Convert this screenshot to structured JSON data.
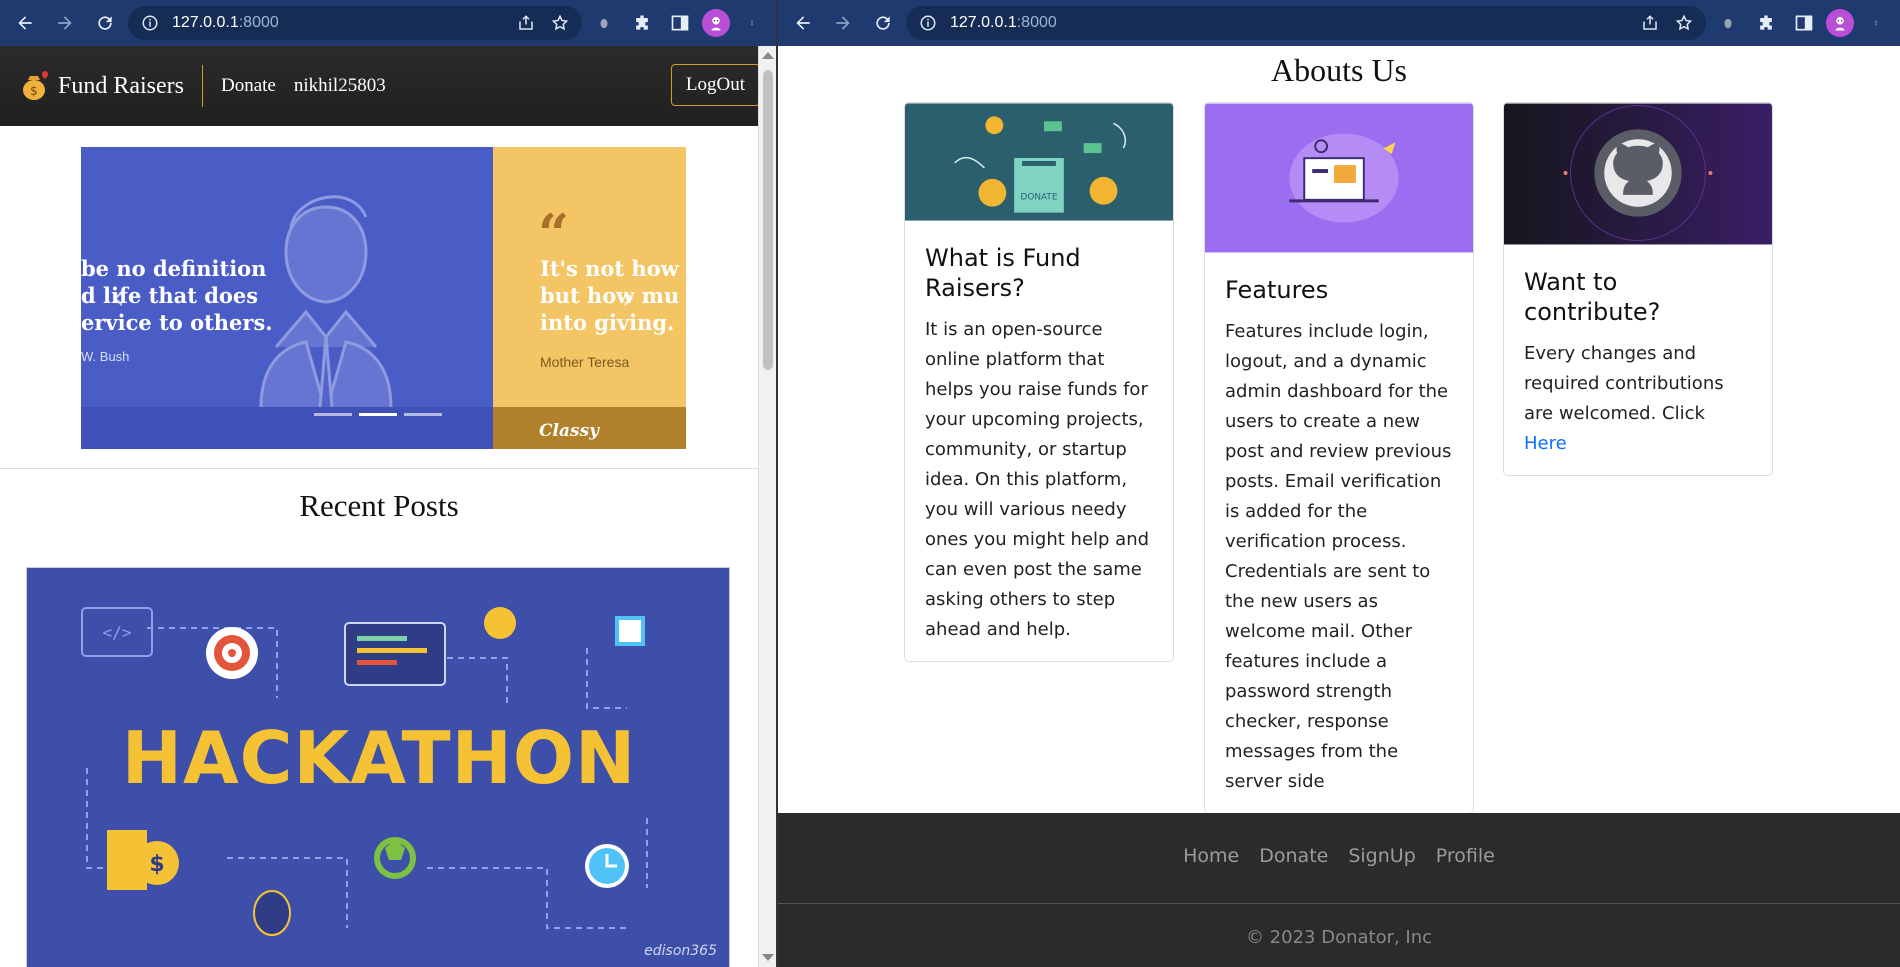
{
  "left_window": {
    "address_bar": {
      "host": "127.0.0.1",
      "port": ":8000"
    },
    "site": {
      "brand": "Fund Raisers",
      "nav_links": [
        "Donate",
        "nikhil25803"
      ],
      "logout_label": "LogOut",
      "carousel": {
        "slide1_quote": "be no definition\nd life that does\nervice to others.",
        "slide1_author": "W. Bush",
        "slide2_quote": "It's not how\nbut how mu\ninto giving.",
        "slide2_author": "Mother Teresa",
        "slide2_brand": "Classy",
        "indicator_count": 3,
        "active_indicator": 2
      },
      "recent_posts_title": "Recent Posts",
      "post_image_text": "HACKATHON",
      "post_image_credit": "edison365"
    }
  },
  "right_window": {
    "address_bar": {
      "host": "127.0.0.1",
      "port": ":8000"
    },
    "about_title": "Abouts Us",
    "cards": [
      {
        "title": "What is Fund Raisers?",
        "text": "It is an open-source online platform that helps you raise funds for your upcoming projects, community, or startup idea. On this platform, you will various needy ones you might help and can even post the same asking others to step ahead and help."
      },
      {
        "title": "Features",
        "text": "Features include login, logout, and a dynamic admin dashboard for the users to create a new post and review previous posts. Email verification is added for the verification process. Credentials are sent to the new users as welcome mail. Other features include a password strength checker, response messages from the server side"
      },
      {
        "title": "Want to contribute?",
        "text": "Every changes and required contributions are welcomed. Click ",
        "link_text": "Here"
      }
    ],
    "donate_box_label": "DONATE",
    "footer": {
      "links": [
        "Home",
        "Donate",
        "SignUp",
        "Profile"
      ],
      "copyright": "© 2023 Donator, Inc"
    }
  },
  "colors": {
    "chrome_bar": "#1e3a6e",
    "omnibox": "#152d55",
    "navbar_accent": "#c9a227",
    "link_blue": "#0d6efd",
    "footer_bg": "#2b2b2b"
  }
}
